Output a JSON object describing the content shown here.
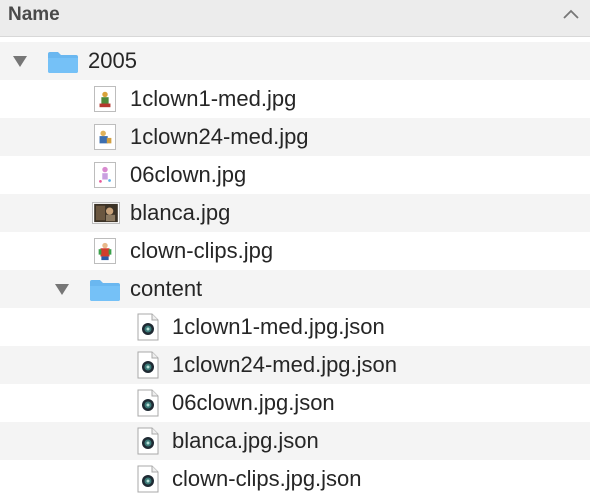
{
  "header": {
    "column_name": "Name",
    "sort_icon": "chevron-up-icon"
  },
  "rows": [
    {
      "label": "2005",
      "kind": "folder",
      "expanded": true,
      "icon": "folder-icon"
    },
    {
      "label": "1clown1-med.jpg",
      "kind": "image",
      "icon": "image-thumbnail"
    },
    {
      "label": "1clown24-med.jpg",
      "kind": "image",
      "icon": "image-thumbnail"
    },
    {
      "label": "06clown.jpg",
      "kind": "image",
      "icon": "image-thumbnail"
    },
    {
      "label": "blanca.jpg",
      "kind": "image",
      "icon": "image-thumbnail"
    },
    {
      "label": "clown-clips.jpg",
      "kind": "image",
      "icon": "image-thumbnail"
    },
    {
      "label": "content",
      "kind": "folder",
      "expanded": true,
      "icon": "folder-icon"
    },
    {
      "label": "1clown1-med.jpg.json",
      "kind": "json",
      "icon": "json-file-icon"
    },
    {
      "label": "1clown24-med.jpg.json",
      "kind": "json",
      "icon": "json-file-icon"
    },
    {
      "label": "06clown.jpg.json",
      "kind": "json",
      "icon": "json-file-icon"
    },
    {
      "label": "blanca.jpg.json",
      "kind": "json",
      "icon": "json-file-icon"
    },
    {
      "label": "clown-clips.jpg.json",
      "kind": "json",
      "icon": "json-file-icon"
    }
  ],
  "colors": {
    "folder_blue": "#6ab7f0",
    "row_alt": "#f4f4f4",
    "header_bg": "#ececec",
    "text": "#262626"
  }
}
